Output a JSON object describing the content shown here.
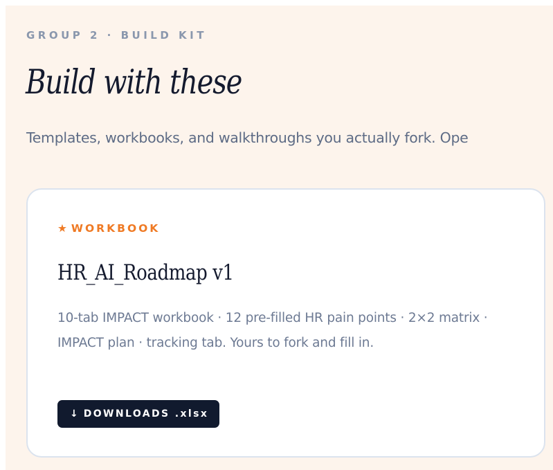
{
  "section": {
    "eyebrow": "GROUP 2 · BUILD KIT",
    "title": "Build with these",
    "subtitle": "Templates, workbooks, and walkthroughs you actually fork. Ope"
  },
  "card": {
    "tag_icon": "★",
    "tag_label": "WORKBOOK",
    "title": "HR_AI_Roadmap v1",
    "description": "10-tab IMPACT workbook · 12 pre-filled HR pain points · 2×2 matrix · IMPACT plan · tracking tab. Yours to fork and fill in.",
    "button_icon": "↓",
    "button_label": "DOWNLOADS .xlsx"
  },
  "colors": {
    "page_background": "#fdf4ec",
    "accent": "#ef7a24",
    "button_background": "#111a2e",
    "heading": "#141a2e",
    "muted_text": "#6d7a93"
  }
}
